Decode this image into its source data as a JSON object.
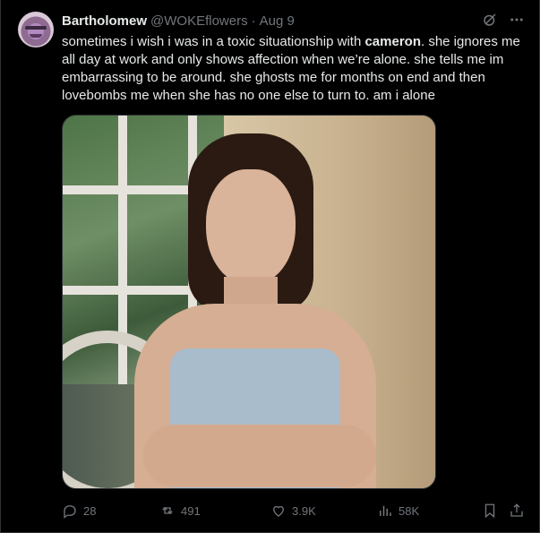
{
  "tweet": {
    "author_name": "Bartholomew",
    "handle": "@WOKEflowers",
    "separator": "·",
    "date": "Aug 9",
    "text_before_bold": "sometimes i wish i was in a toxic situationship with ",
    "text_bold": "cameron",
    "text_after_bold": ". she ignores me all day at work and only shows affection when we’re alone. she tells me im embarrassing to be around. she ghosts me for months on end and then lovebombs me when she has no one else to turn to. am i alone"
  },
  "stats": {
    "replies": "28",
    "reposts": "491",
    "likes": "3.9K",
    "views": "58K"
  },
  "icons": {
    "grok": "slash-circle-icon",
    "more": "more-dots-icon",
    "reply": "reply-icon",
    "repost": "repost-icon",
    "like": "heart-icon",
    "views": "views-bars-icon",
    "bookmark": "bookmark-icon",
    "share": "share-icon"
  },
  "colors": {
    "background": "#000000",
    "text": "#e7e9ea",
    "muted": "#71767b",
    "border": "#2f3336"
  }
}
